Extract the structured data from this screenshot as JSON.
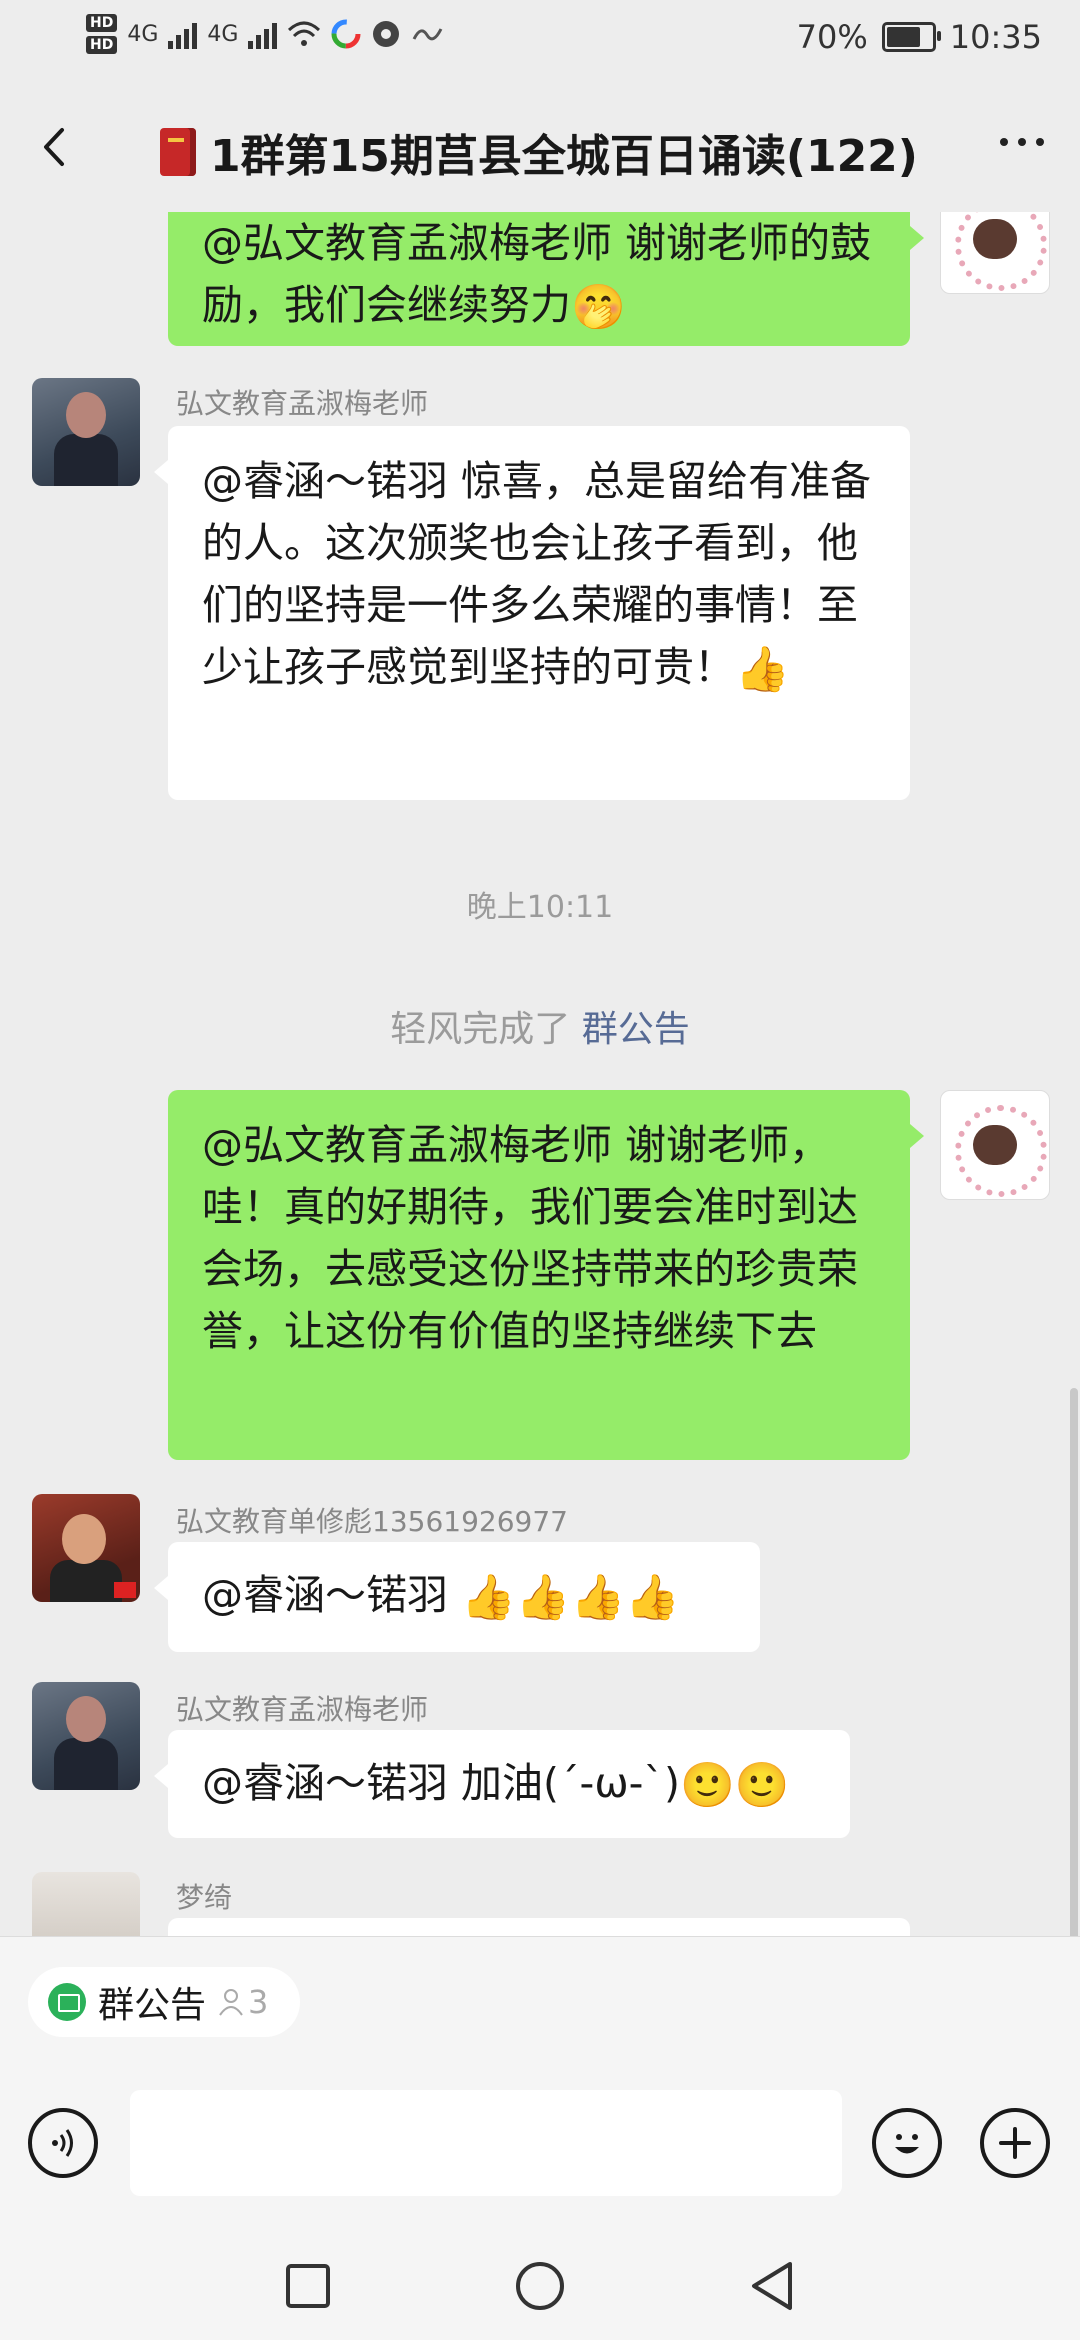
{
  "status_bar": {
    "network_badges": [
      "HD",
      "HD"
    ],
    "signal_labels": [
      "4G",
      "4G"
    ],
    "battery": "70%",
    "battery_level": 0.7,
    "time": "10:35"
  },
  "header": {
    "title": "1群第15期莒县全城百日诵读(122)",
    "back_icon": "chevron-left-icon",
    "more_icon": "more-dots-icon",
    "book_icon": "red-book-icon"
  },
  "messages": [
    {
      "side": "right",
      "text": "@弘文教育孟淑梅老师  谢谢老师的鼓励，我们会继续努力",
      "emoji": "🤭"
    },
    {
      "side": "left",
      "sender": "弘文教育孟淑梅老师",
      "text": "@睿涵～锘羽  惊喜，总是留给有准备的人。这次颁奖也会让孩子看到，他们的坚持是一件多么荣耀的事情！至少让孩子感觉到坚持的可贵！",
      "emoji": "👍"
    },
    {
      "side": "right",
      "text": "@弘文教育孟淑梅老师  谢谢老师，哇！真的好期待，我们要会准时到达会场，去感受这份坚持带来的珍贵荣誉，让这份有价值的坚持继续下去"
    },
    {
      "side": "left",
      "sender": "弘文教育单修彪13561926977",
      "text": "@睿涵～锘羽 ",
      "emoji": "👍👍👍👍"
    },
    {
      "side": "left",
      "sender": "弘文教育孟淑梅老师",
      "text": "@睿涵～锘羽 加油(´-ω-`)",
      "emoji": "🙂🙂"
    },
    {
      "side": "left",
      "sender": "梦绮",
      "text": ""
    }
  ],
  "timestamp": "晚上10:11",
  "system_message": {
    "prefix": "轻风完成了 ",
    "link": "群公告"
  },
  "notice_chip": {
    "label": "群公告",
    "count": "3"
  },
  "input": {
    "placeholder": ""
  },
  "colors": {
    "green_bubble": "#95ec69",
    "white_bubble": "#ffffff",
    "link": "#576b95",
    "chip_icon": "#2bb15a"
  }
}
